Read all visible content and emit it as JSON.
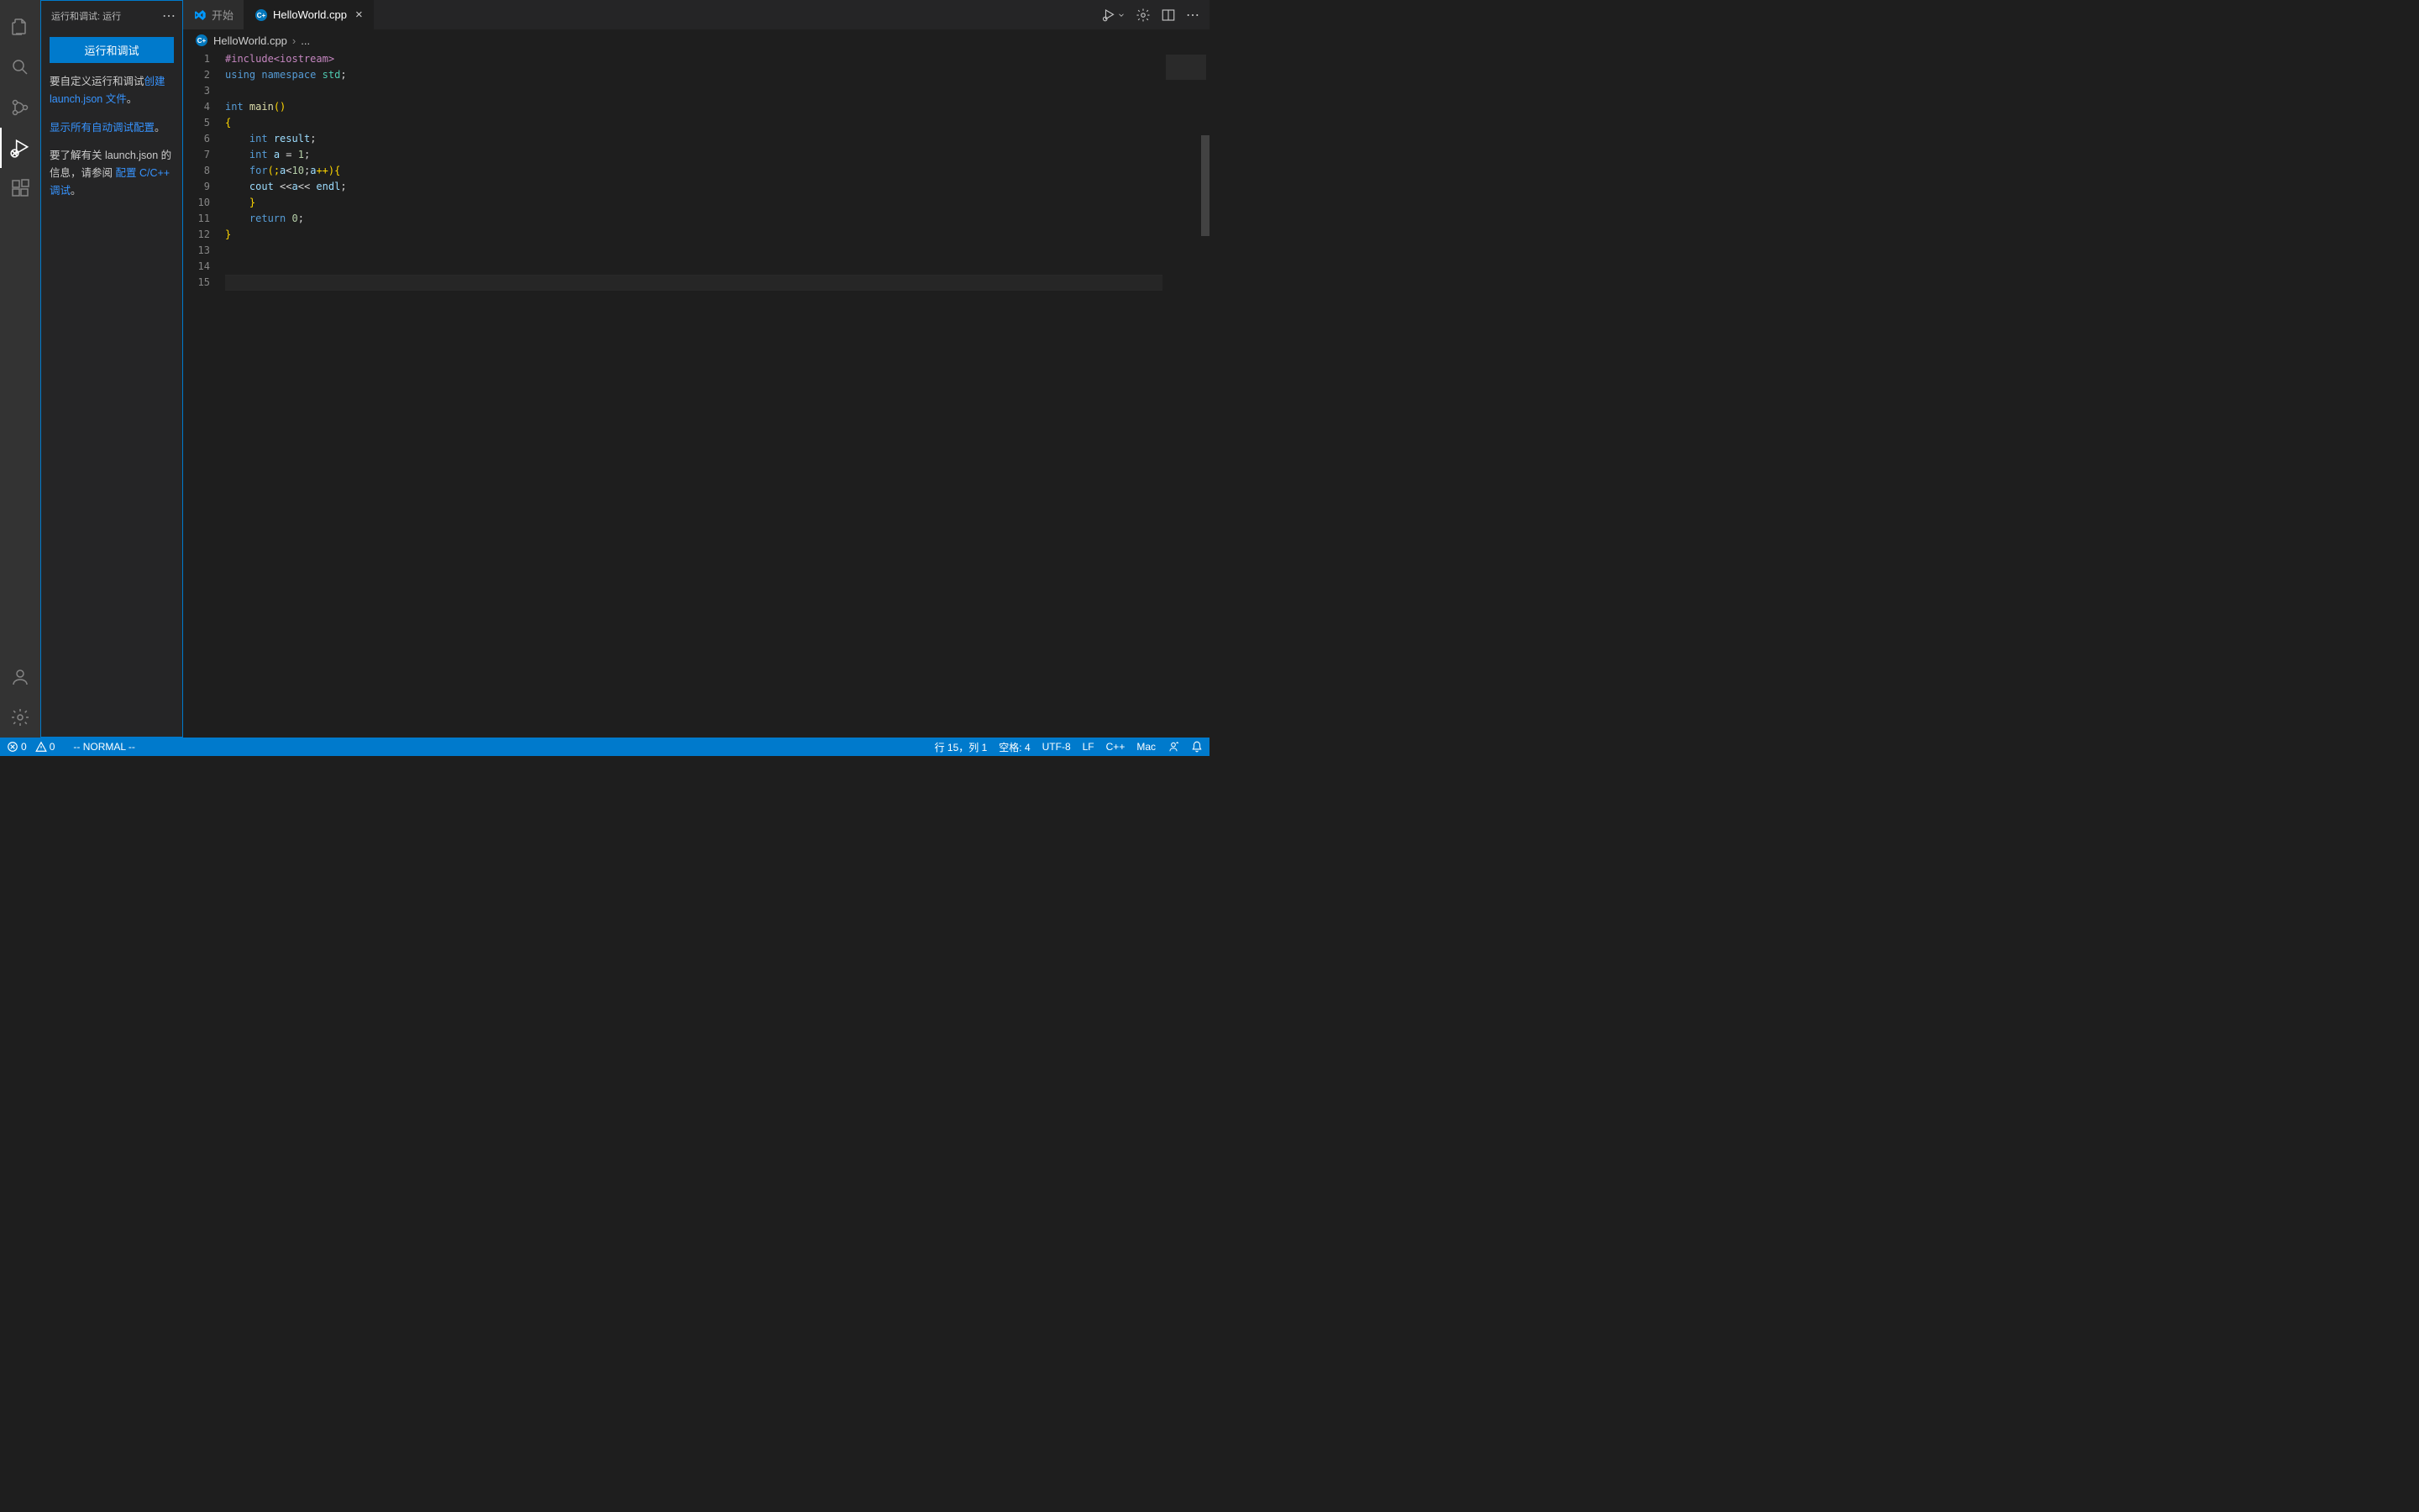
{
  "sidebar": {
    "title": "运行和调试: 运行",
    "runButton": "运行和调试",
    "p1_pre": "要自定义运行和调试",
    "link1": "创建 launch.json 文件",
    "p1_post": "。",
    "link2": "显示所有自动调试配置",
    "p2_post": "。",
    "p3_pre": "要了解有关 launch.json 的信息，请参阅 ",
    "link3": "配置 C/C++ 调试",
    "p3_post": "。"
  },
  "tabs": {
    "tab1": "开始",
    "tab2": "HelloWorld.cpp"
  },
  "breadcrumb": {
    "file": "HelloWorld.cpp",
    "rest": "..."
  },
  "code": {
    "lines": [
      1,
      2,
      3,
      4,
      5,
      6,
      7,
      8,
      9,
      10,
      11,
      12,
      13,
      14,
      15
    ],
    "content": {
      "l1": "#include<iostream>",
      "l2a": "using",
      "l2b": "namespace",
      "l2c": "std",
      "l2d": ";",
      "l4a": "int",
      "l4b": "main",
      "l4c": "()",
      "l5": "{",
      "l6a": "int",
      "l6b": "result",
      "l6c": ";",
      "l7a": "int",
      "l7b": "a",
      "l7c": " = ",
      "l7d": "1",
      "l7e": ";",
      "l8a": "for",
      "l8b": "(;",
      "l8c": "a",
      "l8d": "<",
      "l8e": "10",
      "l8f": ";",
      "l8g": "a",
      "l8h": "++){",
      "l9a": "cout",
      "l9b": " <<",
      "l9c": "a",
      "l9d": "<< ",
      "l9e": "endl",
      "l9f": ";",
      "l10": "}",
      "l11a": "return",
      "l11b": "0",
      "l11c": ";",
      "l12": "}"
    }
  },
  "status": {
    "errors": "0",
    "warnings": "0",
    "vimMode": "-- NORMAL --",
    "lineCol": "行 15，列 1",
    "spaces": "空格: 4",
    "encoding": "UTF-8",
    "eol": "LF",
    "lang": "C++",
    "os": "Mac"
  }
}
